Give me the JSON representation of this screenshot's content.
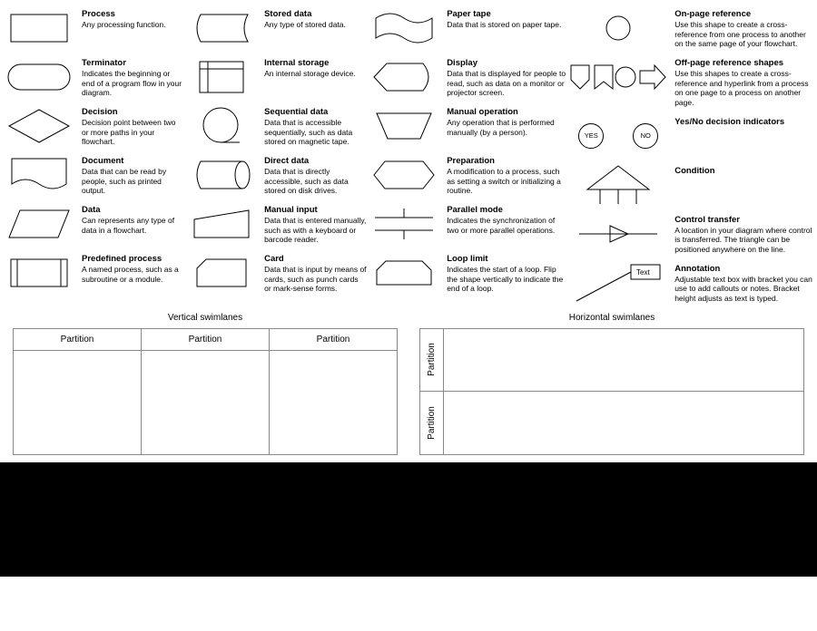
{
  "col1": [
    {
      "title": "Process",
      "desc": "Any processing function."
    },
    {
      "title": "Terminator",
      "desc": "Indicates the beginning or end of a program flow in your diagram."
    },
    {
      "title": "Decision",
      "desc": "Decision point between two or more paths in your flowchart."
    },
    {
      "title": "Document",
      "desc": "Data that can be read by people, such as printed output."
    },
    {
      "title": "Data",
      "desc": "Can represents any type of data in a flowchart."
    },
    {
      "title": "Predefined process",
      "desc": "A named process, such as a subroutine or a module."
    }
  ],
  "col2": [
    {
      "title": "Stored data",
      "desc": "Any type of stored data."
    },
    {
      "title": "Internal storage",
      "desc": "An internal storage device."
    },
    {
      "title": "Sequential data",
      "desc": "Data that is accessible sequentially, such as data stored on magnetic tape."
    },
    {
      "title": "Direct data",
      "desc": "Data that is directly accessible, such as data stored on disk drives."
    },
    {
      "title": "Manual input",
      "desc": "Data that is entered manually, such as with a keyboard or barcode reader."
    },
    {
      "title": "Card",
      "desc": "Data that is input by means of cards, such as punch cards or mark-sense forms."
    }
  ],
  "col3": [
    {
      "title": "Paper tape",
      "desc": "Data that is stored on paper tape."
    },
    {
      "title": "Display",
      "desc": "Data that is displayed for people to read, such as data on a monitor or projector screen."
    },
    {
      "title": "Manual operation",
      "desc": "Any operation that is performed manually (by a person)."
    },
    {
      "title": "Preparation",
      "desc": "A modification to a process, such as setting a switch or initializing a routine."
    },
    {
      "title": "Parallel mode",
      "desc": "Indicates the synchronization of two or more parallel operations."
    },
    {
      "title": "Loop limit",
      "desc": "Indicates the start of a loop. Flip the shape vertically to indicate the end of a loop."
    }
  ],
  "col4": [
    {
      "title": "On-page reference",
      "desc": "Use this shape to create a cross-reference from one process to another on the same page of your flowchart."
    },
    {
      "title": "Off-page reference shapes",
      "desc": "Use this shapes to create a cross-reference and hyperlink from a process on one page to a process on another page."
    },
    {
      "title": "Yes/No decision indicators",
      "desc": ""
    },
    {
      "title": "Condition",
      "desc": ""
    },
    {
      "title": "Control transfer",
      "desc": "A location in your diagram where control is transferred. The triangle can be positioned anywhere on the line."
    },
    {
      "title": "Annotation",
      "desc": "Adjustable text box with bracket you can use to add callouts or notes. Bracket height adjusts as text is typed."
    }
  ],
  "yesno": {
    "yes": "YES",
    "no": "NO"
  },
  "annotation_label": "Text",
  "swim": {
    "vertical_title": "Vertical swimlanes",
    "horizontal_title": "Horizontal swimlanes",
    "partition": "Partition"
  }
}
